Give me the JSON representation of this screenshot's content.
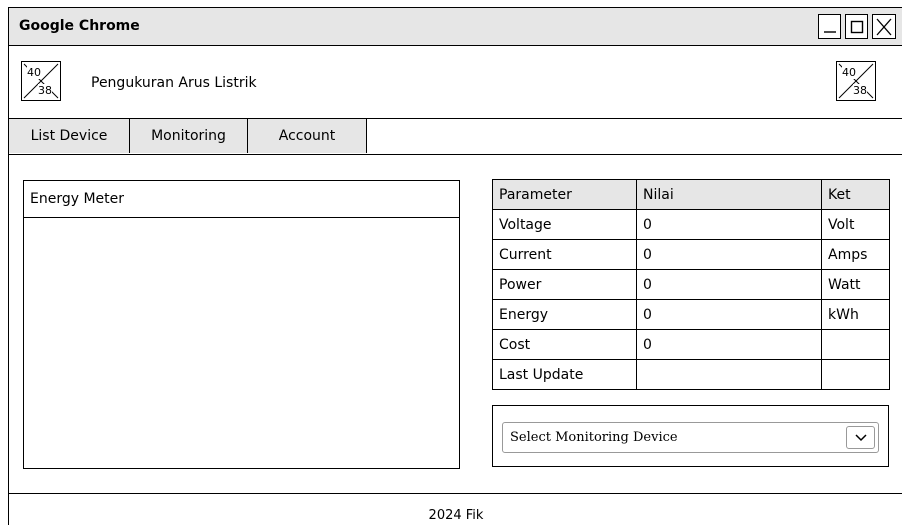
{
  "window": {
    "title": "Google Chrome",
    "controls": [
      "minimize-icon",
      "maximize-icon",
      "close-icon"
    ]
  },
  "header": {
    "logo_left": {
      "top": "40",
      "bottom": "38"
    },
    "logo_right": {
      "top": "40",
      "bottom": "38"
    },
    "app_title": "Pengukuran Arus Listrik"
  },
  "tabs": [
    {
      "label": "List Device"
    },
    {
      "label": "Monitoring"
    },
    {
      "label": "Account"
    }
  ],
  "energy_panel": {
    "title": "Energy Meter"
  },
  "table": {
    "headers": [
      "Parameter",
      "Nilai",
      "Ket"
    ],
    "rows": [
      [
        "Voltage",
        "0",
        "Volt"
      ],
      [
        "Current",
        "0",
        "Amps"
      ],
      [
        "Power",
        "0",
        "Watt"
      ],
      [
        "Energy",
        "0",
        "kWh"
      ],
      [
        "Cost",
        "0",
        ""
      ],
      [
        "Last Update",
        "",
        ""
      ]
    ]
  },
  "device_select": {
    "value": "Select Monitoring Device",
    "icon": "chevron-down-icon"
  },
  "footer": {
    "text": "2024 Fik"
  }
}
